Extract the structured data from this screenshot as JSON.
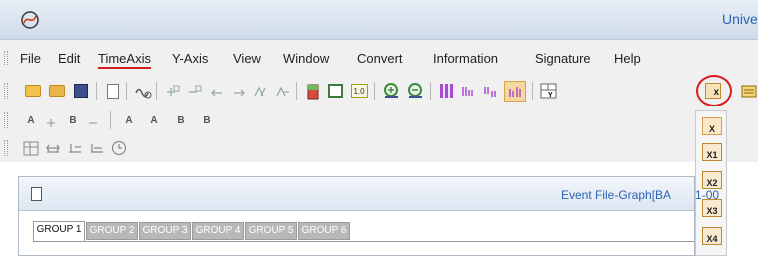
{
  "app": {
    "title": "Unive"
  },
  "menubar": {
    "items": [
      "File",
      "Edit",
      "TimeAxis",
      "Y-Axis",
      "View",
      "Window",
      "Convert",
      "Information",
      "Signature",
      "Help"
    ],
    "active_item": "TimeAxis"
  },
  "toolbar2": {
    "a_label": "A",
    "b_label": "B",
    "ab_label_1": "A",
    "ab_label_2": "B",
    "a_end_label": "A",
    "b_end_label": "B"
  },
  "toolbar1": {
    "one_label": "1.0"
  },
  "graph_window": {
    "title": "Event File-Graph[BA",
    "title_suffix": "1-00"
  },
  "tabs": [
    "GROUP 1",
    "GROUP 2",
    "GROUP 3",
    "GROUP 4",
    "GROUP 5",
    "GROUP 6"
  ],
  "active_tab": "GROUP 1",
  "dropdown": {
    "items": [
      "X",
      "X1",
      "X2",
      "X3",
      "X4"
    ]
  },
  "colors": {
    "title_text": "#2c62b8",
    "highlight_ring": "#d81b1b",
    "menu_underline": "#d02020"
  }
}
